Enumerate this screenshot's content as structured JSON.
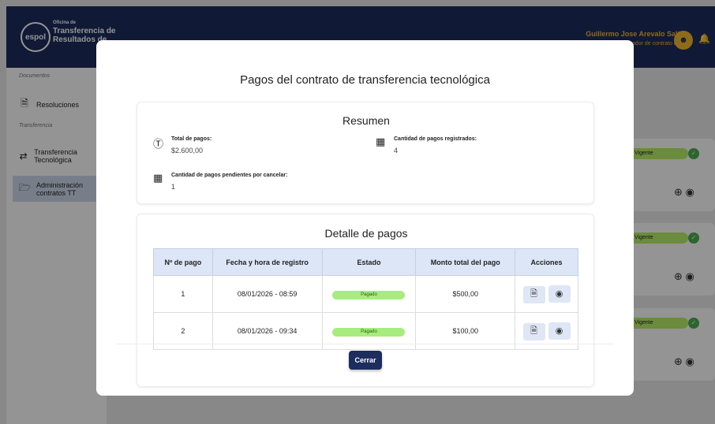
{
  "header": {
    "logo_text": "espol",
    "office_label": "Oficina de",
    "office_name": "Transferencia de Resultados de",
    "user_name": "Guillermo Jose Arevalo Saltos",
    "user_role": "Administrador de contrato de TT"
  },
  "sidebar": {
    "section_documents": "Documentos",
    "section_transfer": "Transferencia",
    "items": [
      {
        "label": "Resoluciones",
        "icon": "document-icon"
      },
      {
        "label": "Transferencia Tecnológica",
        "icon": "transfer-arrows-icon"
      },
      {
        "label": "Administración contratos TT",
        "icon": "folder-icon"
      }
    ]
  },
  "background_cards": [
    {
      "badge": "Vigente"
    },
    {
      "badge": "Vigente"
    },
    {
      "badge": "Vigente"
    }
  ],
  "modal": {
    "title": "Pagos del contrato de transferencia tecnológica",
    "summary": {
      "title": "Resumen",
      "total_label": "Total de pagos:",
      "total_value": "$2.600,00",
      "count_label": "Cantidad de pagos registrados:",
      "count_value": "4",
      "pending_label": "Cantidad de pagos pendientes por cancelar:",
      "pending_value": "1"
    },
    "detail": {
      "title": "Detalle de pagos",
      "columns": [
        "Nº de pago",
        "Fecha y hora de registro",
        "Estado",
        "Monto total del pago",
        "Acciones"
      ],
      "rows": [
        {
          "number": "1",
          "date": "08/01/2026 - 08:59",
          "status": "Pagado",
          "amount": "$500,00"
        },
        {
          "number": "2",
          "date": "08/01/2026 - 09:34",
          "status": "Pagado",
          "amount": "$100,00"
        }
      ]
    },
    "close_label": "Cerrar"
  }
}
